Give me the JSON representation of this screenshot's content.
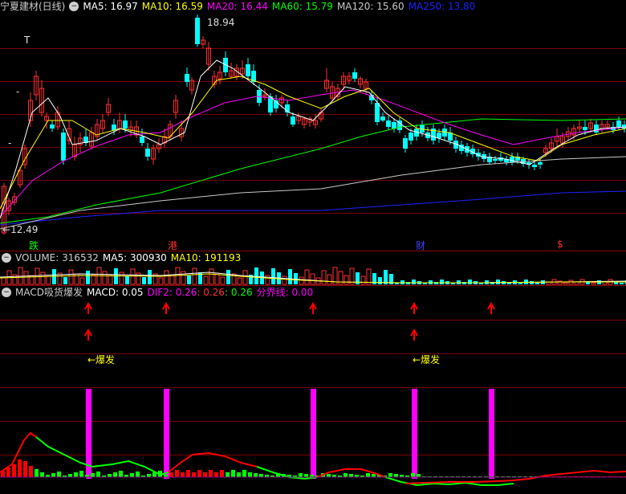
{
  "price_panel": {
    "title": "宁夏建材(日线)",
    "ma": [
      {
        "label": "MA5: 16.97",
        "color": "#ffffff"
      },
      {
        "label": "MA10: 16.59",
        "color": "#ffff00"
      },
      {
        "label": "MA20: 16.44",
        "color": "#ff00ff"
      },
      {
        "label": "MA60: 15.79",
        "color": "#00ff00"
      },
      {
        "label": "MA120: 15.60",
        "color": "#c8c8c8"
      },
      {
        "label": "MA250: 13.80",
        "color": "#2020ff"
      }
    ],
    "high_label": "18.94",
    "low_label": "12.49",
    "event_marks": [
      {
        "text": "跌",
        "color": "#00ff00"
      },
      {
        "text": "港",
        "color": "#ff3030"
      },
      {
        "text": "财",
        "color": "#4040ff"
      },
      {
        "text": "$",
        "color": "#ff3030"
      }
    ],
    "t_marks": [
      "T",
      "-",
      "-"
    ]
  },
  "volume_panel": {
    "labels": [
      {
        "label": "VOLUME: 316532",
        "color": "#cccccc"
      },
      {
        "label": "MA5: 300930",
        "color": "#ffffff"
      },
      {
        "label": "MA10: 191193",
        "color": "#ffff00"
      }
    ]
  },
  "macd_panel": {
    "labels": [
      {
        "label": "MACD吸货爆发",
        "color": "#cccccc"
      },
      {
        "label": "MACD: 0.05",
        "color": "#ffffff"
      },
      {
        "label": "DIF2: 0.26",
        "color": "#ff00ff"
      },
      {
        "label": ": 0.26",
        "color": "#ff3030"
      },
      {
        "label": ": 0.26",
        "color": "#00ff00"
      },
      {
        "label": "分界线: 0.00",
        "color": "#ff00ff"
      }
    ],
    "burst_label": "←爆发",
    "signal_color": "#ff00ff",
    "arrow_color": "#ff0000"
  },
  "icons": {
    "collapse": "circle-minus-icon"
  }
}
